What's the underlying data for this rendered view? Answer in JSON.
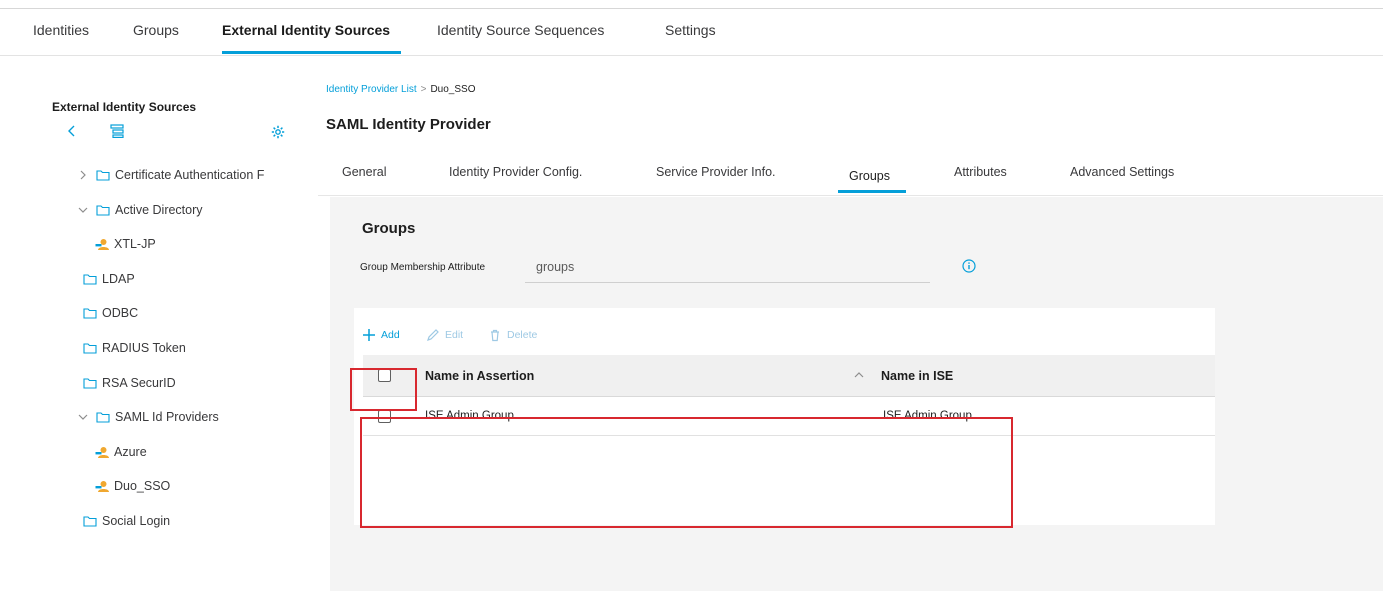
{
  "top_tabs": [
    {
      "label": "Identities"
    },
    {
      "label": "Groups"
    },
    {
      "label": "External Identity Sources",
      "active": true
    },
    {
      "label": "Identity Source Sequences"
    },
    {
      "label": "Settings"
    }
  ],
  "sidebar": {
    "title": "External Identity Sources",
    "tools": {
      "back_icon": "chevron-left-icon",
      "tree_icon": "tree-view-icon",
      "settings_icon": "gear-icon"
    },
    "tree": [
      {
        "label": "Certificate Authentication F",
        "icon": "folder-icon",
        "expanded": false
      },
      {
        "label": "Active Directory",
        "icon": "folder-icon",
        "expanded": true
      },
      {
        "label": "XTL-JP",
        "icon": "identity-store-icon"
      },
      {
        "label": "LDAP",
        "icon": "folder-icon"
      },
      {
        "label": "ODBC",
        "icon": "folder-icon"
      },
      {
        "label": "RADIUS Token",
        "icon": "folder-icon"
      },
      {
        "label": "RSA SecurID",
        "icon": "folder-icon"
      },
      {
        "label": "SAML Id Providers",
        "icon": "folder-icon",
        "expanded": true
      },
      {
        "label": "Azure",
        "icon": "identity-store-icon"
      },
      {
        "label": "Duo_SSO",
        "icon": "identity-store-icon"
      },
      {
        "label": "Social Login",
        "icon": "folder-icon"
      }
    ]
  },
  "main": {
    "breadcrumb": {
      "link": "Identity Provider List",
      "separator": ">",
      "current": "Duo_SSO"
    },
    "title": "SAML Identity Provider",
    "sub_tabs": [
      {
        "label": "General"
      },
      {
        "label": "Identity Provider Config."
      },
      {
        "label": "Service Provider Info."
      },
      {
        "label": "Groups",
        "active": true
      },
      {
        "label": "Attributes"
      },
      {
        "label": "Advanced Settings"
      }
    ],
    "groups": {
      "section_title": "Groups",
      "membership_label": "Group Membership Attribute",
      "membership_value": "groups",
      "toolbar": {
        "add": "Add",
        "edit": "Edit",
        "delete": "Delete"
      },
      "table": {
        "columns": [
          "Name in Assertion",
          "Name in ISE"
        ],
        "rows": [
          [
            "ISE Admin Group",
            "ISE Admin Group"
          ]
        ]
      }
    }
  },
  "colors": {
    "accent": "#049fd9",
    "highlight": "#d8282f",
    "panel_bg": "#f4f4f4"
  }
}
